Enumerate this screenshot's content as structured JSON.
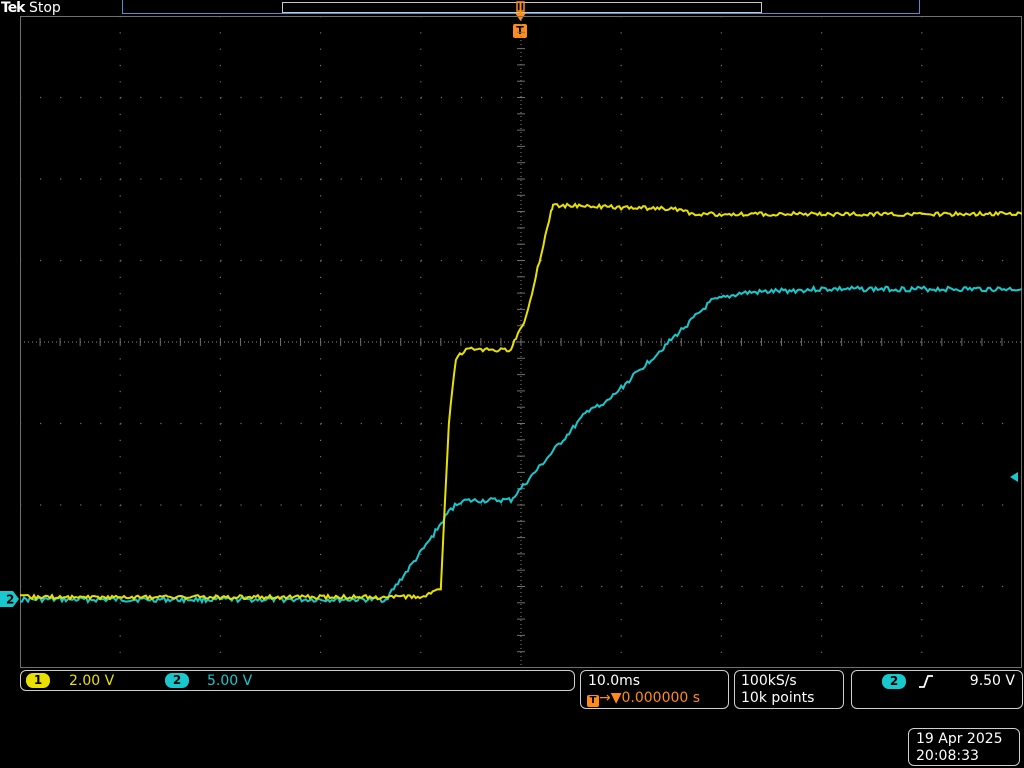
{
  "header": {
    "brand": "Tek",
    "status": "Stop"
  },
  "trigger_marker": {
    "label": "T"
  },
  "channel1": {
    "number": "1",
    "scale": "2.00 V",
    "color": "#e8e000"
  },
  "channel2": {
    "number": "2",
    "scale": "5.00 V",
    "color": "#18c8cc"
  },
  "timebase": {
    "scale": "10.0ms",
    "position": "0.000000 s",
    "position_icon": "T"
  },
  "acquisition": {
    "sample_rate": "100kS/s",
    "record_length": "10k points"
  },
  "trigger": {
    "source": "2",
    "slope_icon": "rising-edge-icon",
    "level": "9.50 V"
  },
  "datetime": {
    "date": "19 Apr 2025",
    "time": "20:08:33"
  },
  "accent": {
    "trigger": "#ff8c1a",
    "graticule": "#707070"
  }
}
